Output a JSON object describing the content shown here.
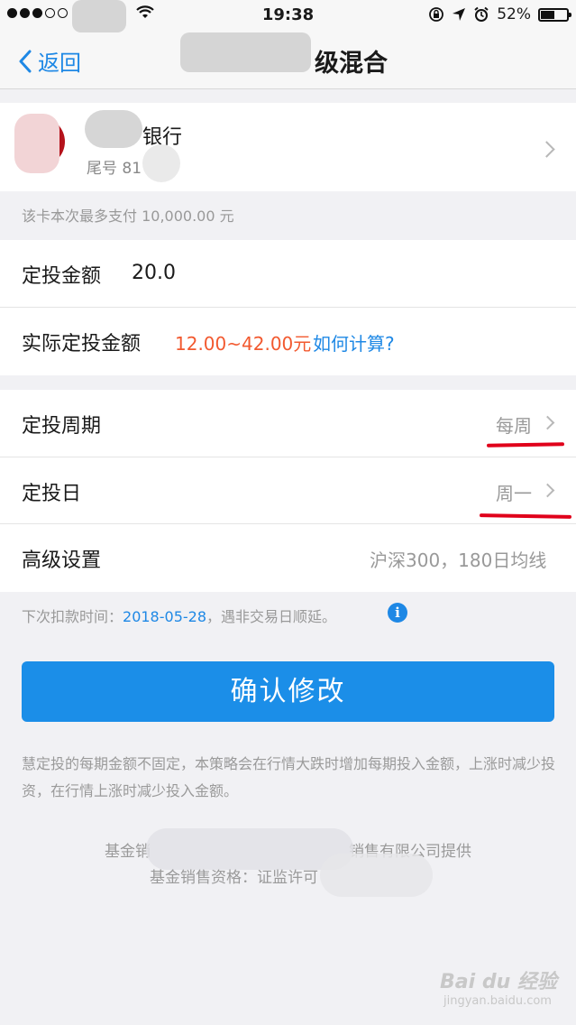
{
  "status_bar": {
    "time": "19:38",
    "battery_percent": "52%",
    "battery_level": 0.52
  },
  "nav": {
    "back_label": "返回",
    "title_visible": "级混合"
  },
  "bank_card": {
    "name_visible": "银行",
    "tail_label": "尾号 81"
  },
  "card_limit_hint": "该卡本次最多支付 10,000.00 元",
  "amount_section": {
    "amount_label": "定投金额",
    "amount_value": "20.0",
    "actual_label": "实际定投金额",
    "actual_range": "12.00~42.00元",
    "how_calc_link": "如何计算?"
  },
  "settings_section": {
    "period_label": "定投周期",
    "period_value": "每周",
    "day_label": "定投日",
    "day_value": "周一",
    "advanced_label": "高级设置",
    "advanced_value": "沪深300，180日均线"
  },
  "next_deduction": {
    "prefix": "下次扣款时间：",
    "date": "2018-05-28",
    "suffix": "，遇非交易日顺延。",
    "info_icon_glyph": "i"
  },
  "confirm_button": "确认修改",
  "description": "慧定投的每期金额不固定，本策略会在行情大跌时增加每期投入金额，上涨时减少投资，在行情上涨时减少投入金额。",
  "footer": {
    "line1_start": "基金销",
    "line1_end": "销售有限公司提供",
    "line2": "基金销售资格：证监许可"
  },
  "watermark": {
    "brand": "Bai du 经验",
    "sub": "jingyan.baidu.com"
  },
  "colors": {
    "accent_blue": "#1e88e5",
    "button_blue": "#1b8ee8",
    "range_orange": "#f2592f",
    "annotation_red": "#e0001a"
  }
}
